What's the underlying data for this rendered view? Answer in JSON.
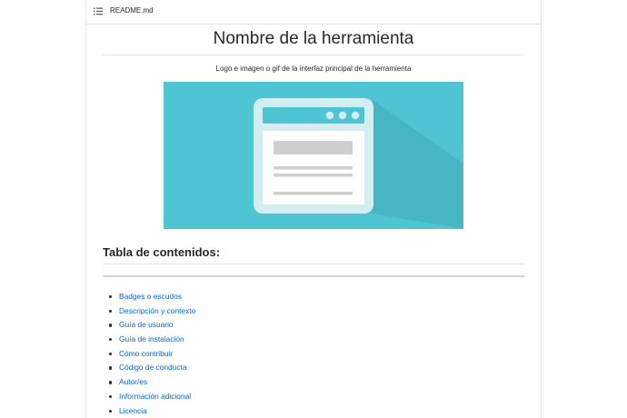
{
  "file": {
    "icon": "list-icon",
    "name": "README.md"
  },
  "document": {
    "title": "Nombre de la herramienta",
    "caption": "Logo e imagen o gif de la interfaz principal de la herramienta",
    "hero_image": {
      "icon": "browser-window-illustration",
      "background_color": "#4fc4d2"
    },
    "toc_heading": "Tabla de contenidos:",
    "toc_items": [
      "Badges o escudos",
      "Descripción y contexto",
      "Guía de usuario",
      "Guía de instalación",
      "Cómo contribuir",
      "Código de conducta",
      "Autor/es",
      "Información adicional",
      "Licencia"
    ]
  },
  "colors": {
    "link": "#0366d6",
    "text": "#24292e",
    "hero_background": "#4fc4d2",
    "divider": "#e1e4e8"
  }
}
